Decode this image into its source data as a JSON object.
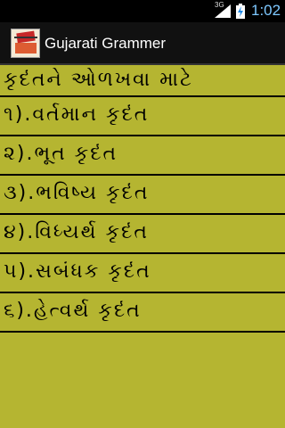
{
  "status_bar": {
    "network": "3G",
    "time": "1:02",
    "icons": [
      "signal-icon",
      "battery-charging-icon"
    ]
  },
  "app": {
    "title": "Gujarati Grammer",
    "icon": "app-logo-icon"
  },
  "list": {
    "header": "કૃદંતને ઓળખવા માટે",
    "items": [
      "૧).વર્તમાન કૃદંત",
      "૨).ભૂત કૃદંત",
      "૩).ભવિષ્ય કૃદંત",
      "૪).વિધ્યર્થ કૃદંત",
      "૫).સબંધક કૃદંત",
      "૬).હેત્વર્થ કૃદંત"
    ]
  },
  "colors": {
    "background": "#B5B531",
    "action_bar": "#111111",
    "status_bar": "#000000",
    "divider": "#000000"
  }
}
